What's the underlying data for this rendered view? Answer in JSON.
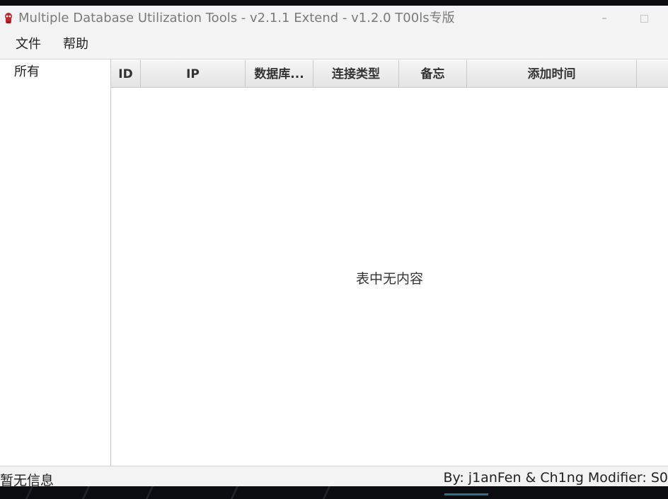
{
  "window": {
    "title": "Multiple Database Utilization Tools - v2.1.1 Extend - v1.2.0 T00ls专版",
    "minimize_glyph": "–"
  },
  "menu": {
    "file": "文件",
    "help": "帮助"
  },
  "sidebar": {
    "items": [
      {
        "label": "所有"
      }
    ]
  },
  "table": {
    "columns": [
      "ID",
      "IP",
      "数据库...",
      "连接类型",
      "备忘",
      "添加时间",
      ""
    ],
    "rows": [],
    "empty_text": "表中无内容"
  },
  "status": {
    "left": "暂无信息",
    "right": "By: j1anFen & Ch1ng Modifier: S0"
  },
  "colors": {
    "accent_icon": "#c0282d",
    "taskbar_glow": "#2b6f8e"
  },
  "icons": {
    "app": "red-lock-logo-icon"
  }
}
